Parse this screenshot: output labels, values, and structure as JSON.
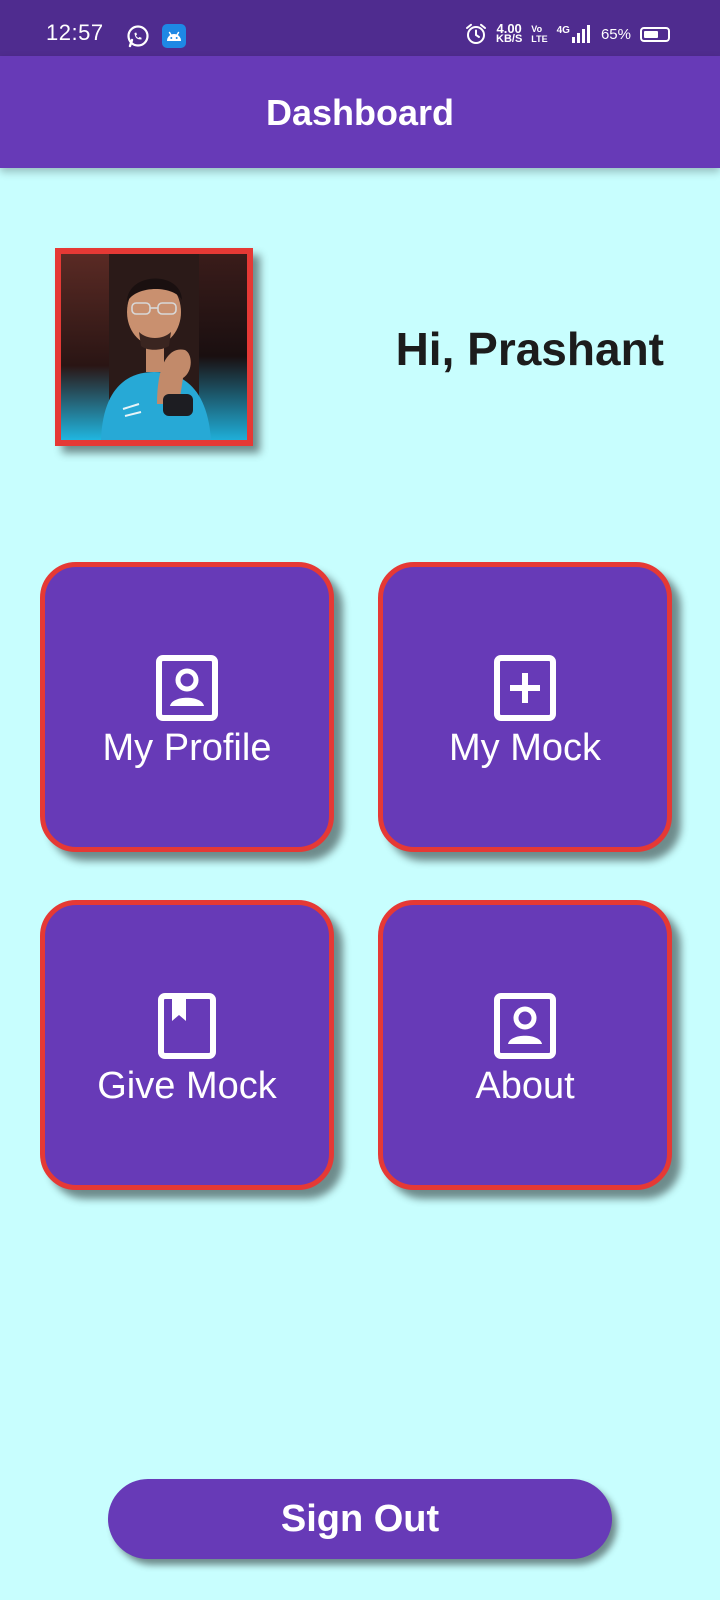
{
  "status_bar": {
    "time": "12:57",
    "net_speed_value": "4.00",
    "net_speed_unit": "KB/S",
    "volte_top": "Vo",
    "volte_bottom": "LTE",
    "network": "4G",
    "battery": "65%",
    "battery_level": 0.65,
    "icons": [
      "whatsapp-icon",
      "android-icon",
      "alarm-icon",
      "signal-icon",
      "battery-icon"
    ]
  },
  "app_bar": {
    "title": "Dashboard"
  },
  "greeting": "Hi, Prashant",
  "tiles": [
    {
      "label": "My Profile",
      "icon": "profile-card-icon"
    },
    {
      "label": "My Mock",
      "icon": "add-box-icon"
    },
    {
      "label": "Give Mock",
      "icon": "bookmark-book-icon"
    },
    {
      "label": "About",
      "icon": "profile-card-icon"
    }
  ],
  "sign_out_label": "Sign Out",
  "colors": {
    "background": "#c8fefe",
    "status_bar": "#4f2c8f",
    "primary": "#673ab7",
    "tile_border": "#e53935",
    "greeting_text": "#1c1c1c"
  }
}
